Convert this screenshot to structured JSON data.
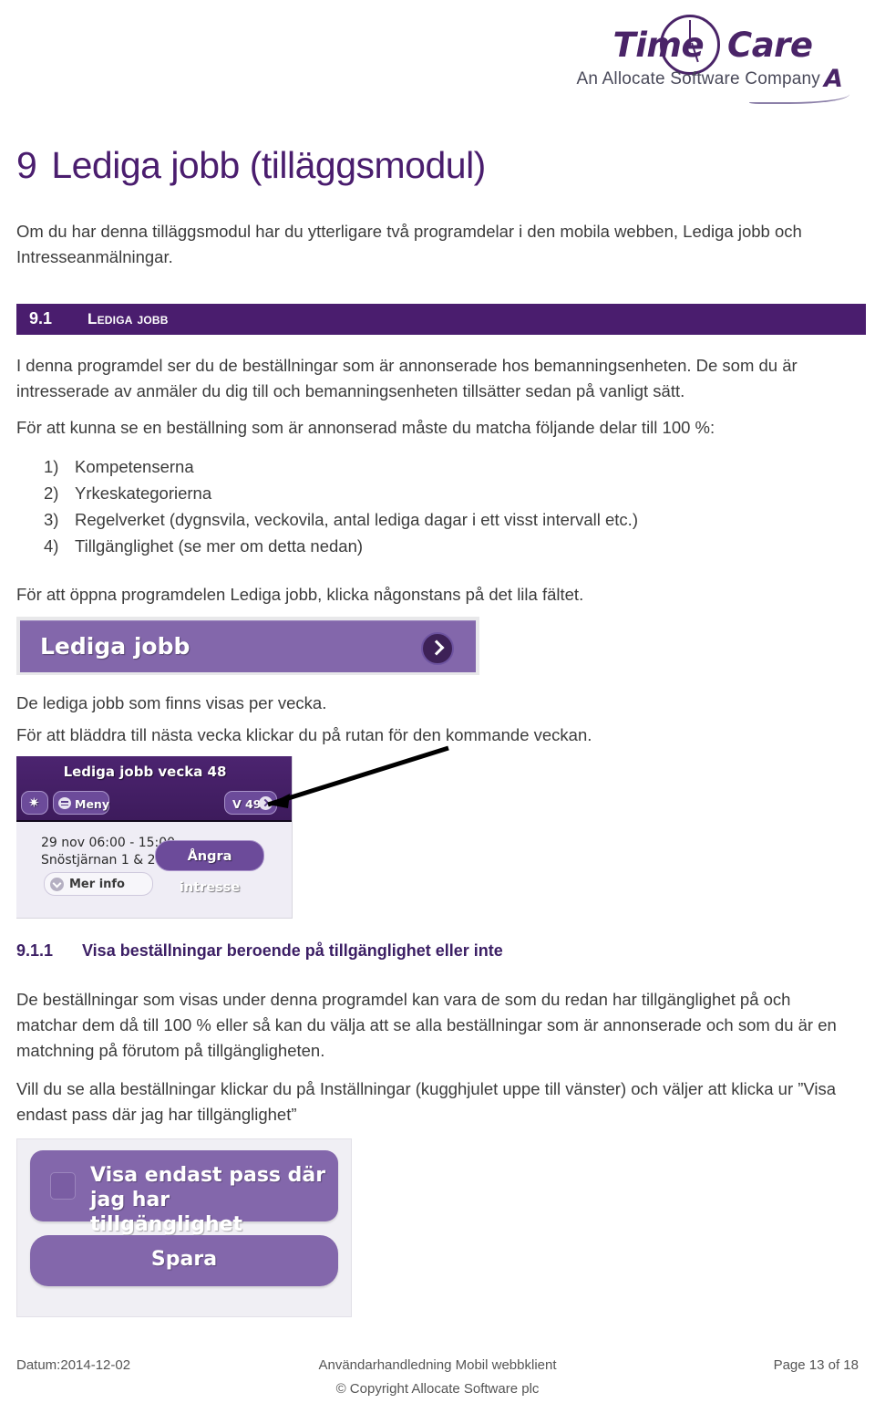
{
  "logo": {
    "word_time": "Time",
    "word_care": "Care",
    "tagline": "An Allocate Software Company",
    "a_glyph": "A",
    "brand_purple": "#4a2468"
  },
  "heading": {
    "number": "9",
    "title": "Lediga jobb (tilläggsmodul)"
  },
  "intro": "Om du har denna tilläggsmodul har du ytterligare två programdelar i den mobila webben, Lediga jobb och Intresseanmälningar.",
  "section": {
    "number": "9.1",
    "title": "Lediga jobb",
    "band_color": "#4a1d6e"
  },
  "body": {
    "p1": "I denna programdel ser du de beställningar som är annonserade hos bemanningsenheten. De som du är intresserade av anmäler du dig till och bemanningsenheten tillsätter sedan på vanligt sätt.",
    "p2": "För att kunna se en beställning som är annonserad måste du matcha följande delar till 100 %:",
    "list": [
      {
        "marker": "1)",
        "text": "Kompetenserna"
      },
      {
        "marker": "2)",
        "text": "Yrkeskategorierna"
      },
      {
        "marker": "3)",
        "text": "Regelverket (dygnsvila, veckovila, antal lediga dagar i ett visst intervall etc.)"
      },
      {
        "marker": "4)",
        "text": "Tillgänglighet (se mer om detta nedan)"
      }
    ],
    "p3": "För att öppna programdelen Lediga jobb, klicka någonstans på det lila fältet.",
    "p4": "De lediga jobb som finns visas per vecka.",
    "p5": "För att bläddra till nästa vecka klickar du på rutan för den kommande veckan."
  },
  "shot_bar": {
    "label": "Lediga jobb",
    "chevron_icon": "chevron-right-icon",
    "fill_color": "#8367ab"
  },
  "shot_week": {
    "title": "Lediga jobb vecka 48",
    "gear_icon": "gear-icon",
    "gear_glyph": "✷",
    "menu_icon": "hamburger-icon",
    "menu_label": "Meny",
    "week_button": "V 49",
    "week_chevron_icon": "chevron-right-icon",
    "shift_time": "29 nov 06:00 - 15:00",
    "shift_unit": "Snöstjärnan 1 & 2",
    "cancel_interest_button": "Ångra intresse",
    "more_info_button": "Mer info",
    "more_info_icon": "chevron-down-circle-icon",
    "header_color": "#4c2470"
  },
  "subsection": {
    "number": "9.1.1",
    "title": "Visa beställningar beroende på tillgänglighet eller inte",
    "color": "#3b1e64"
  },
  "body2": {
    "p1": "De beställningar som visas under denna programdel kan vara de som du redan har tillgänglighet på och matchar dem då till 100 % eller så kan du välja att se alla beställningar som är annonserade och som du är en matchning på förutom på tillgängligheten.",
    "p2": "Vill du se alla beställningar klickar du på Inställningar (kugghjulet uppe till vänster) och väljer att klicka ur ”Visa endast pass där jag har tillgänglighet”"
  },
  "shot_settings": {
    "checkbox_label": "Visa endast pass där jag har tillgänglighet",
    "checkbox_checked": false,
    "save_button": "Spara",
    "button_color": "#8367ab"
  },
  "footer": {
    "date": "Datum:2014-12-02",
    "doc_title": "Användarhandledning Mobil webbklient",
    "page": "Page 13 of 18",
    "copyright": "© Copyright Allocate Software plc"
  }
}
